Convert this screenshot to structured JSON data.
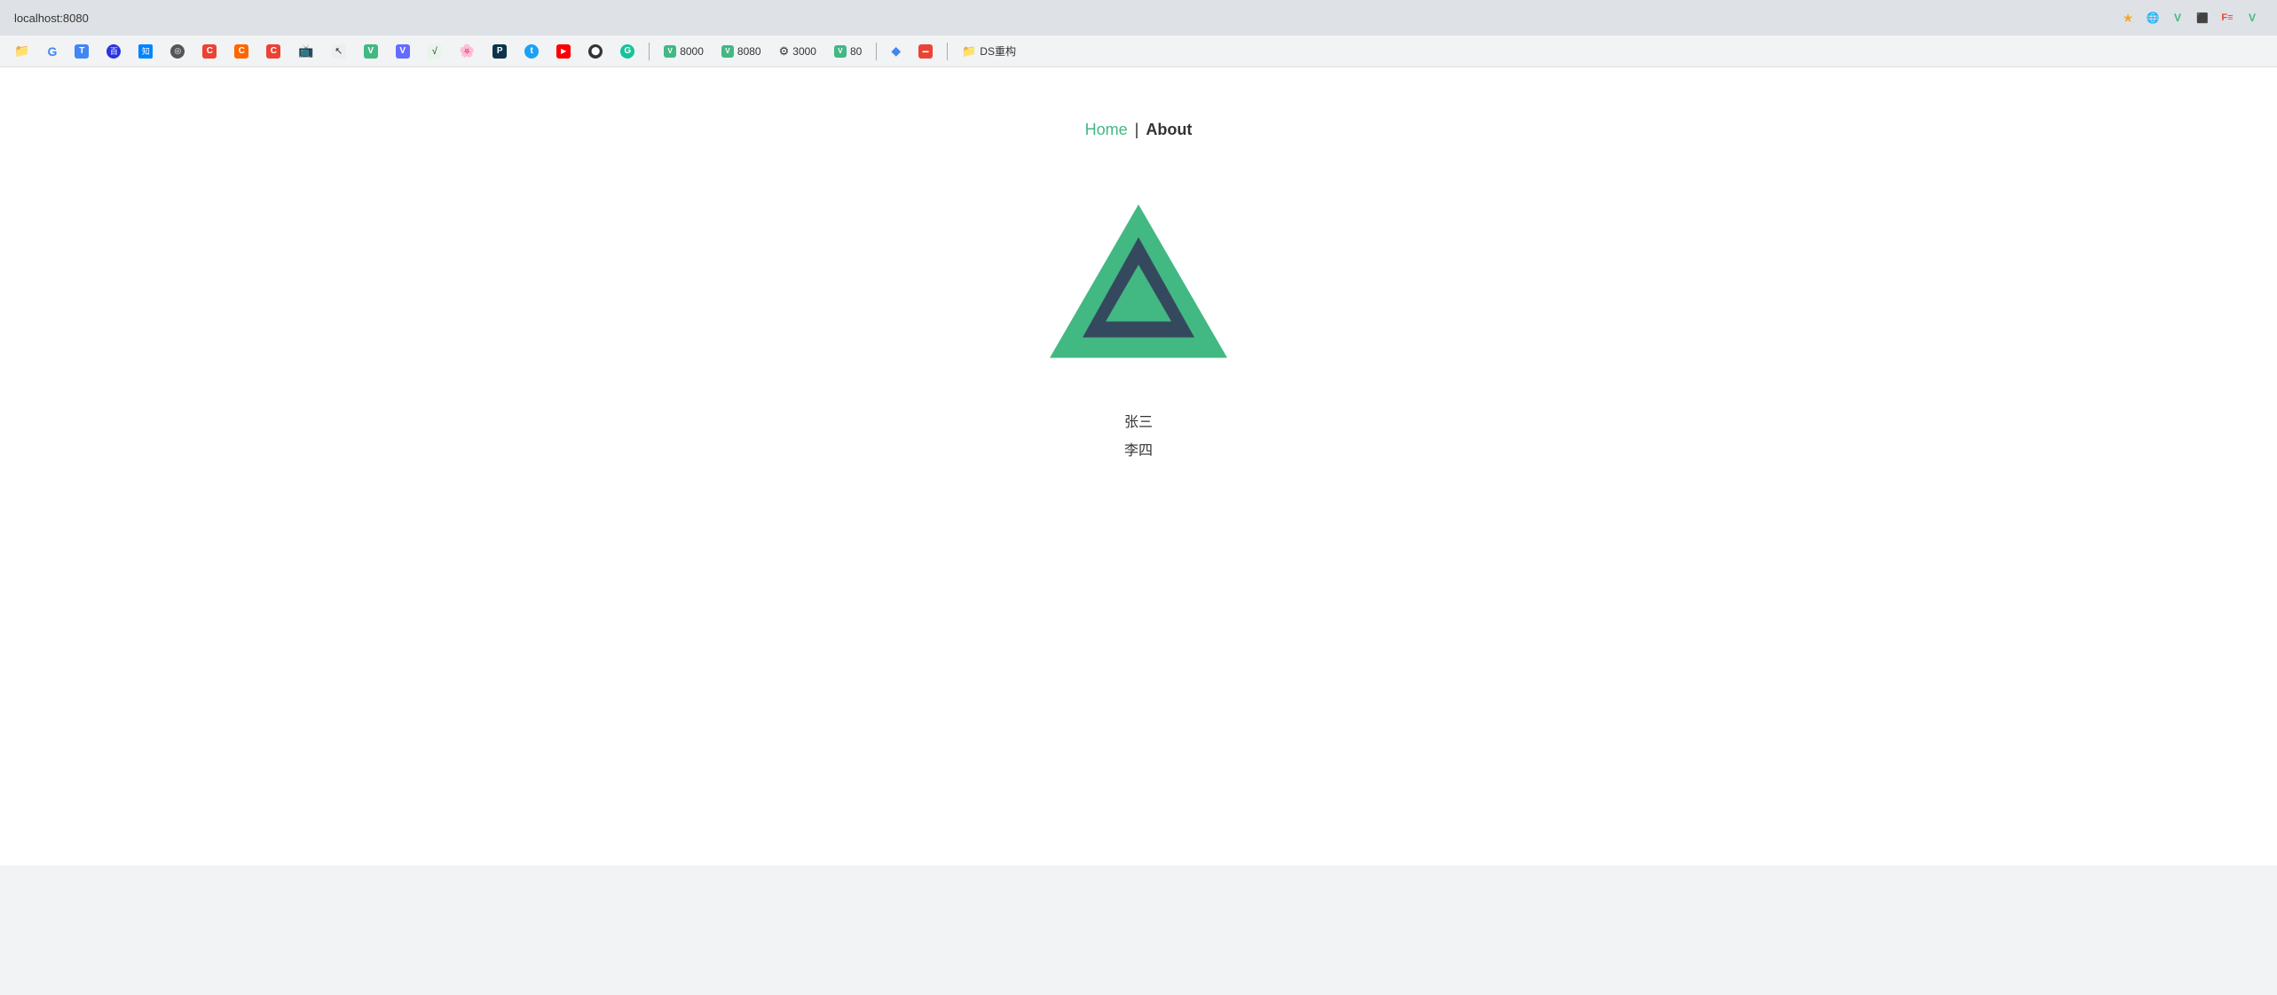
{
  "browser": {
    "url": "localhost:8080",
    "title": "localhost:8080"
  },
  "bookmarks": [
    {
      "id": "folder",
      "label": "",
      "icon": "folder",
      "type": "folder"
    },
    {
      "id": "google",
      "label": "",
      "icon": "G",
      "color": "google"
    },
    {
      "id": "translate",
      "label": "",
      "icon": "T",
      "color": "blue"
    },
    {
      "id": "baidu",
      "label": "",
      "icon": "百",
      "color": "blue"
    },
    {
      "id": "zhihu",
      "label": "",
      "icon": "知",
      "color": "blue"
    },
    {
      "id": "site1",
      "label": "",
      "icon": "◎",
      "color": "dark"
    },
    {
      "id": "c1",
      "label": "",
      "icon": "C",
      "color": "red"
    },
    {
      "id": "c2",
      "label": "",
      "icon": "C",
      "color": "orange"
    },
    {
      "id": "c3",
      "label": "",
      "icon": "C",
      "color": "red"
    },
    {
      "id": "tv",
      "label": "",
      "icon": "📺",
      "color": "blue"
    },
    {
      "id": "cursor",
      "label": "",
      "icon": "↖",
      "color": "dark"
    },
    {
      "id": "vue1",
      "label": "",
      "icon": "V",
      "color": "green"
    },
    {
      "id": "vite",
      "label": "",
      "icon": "V",
      "color": "dark"
    },
    {
      "id": "math",
      "label": "",
      "icon": "√",
      "color": "dark"
    },
    {
      "id": "flower",
      "label": "",
      "icon": "❀",
      "color": "dark"
    },
    {
      "id": "prisma",
      "label": "",
      "icon": "P",
      "color": "blue"
    },
    {
      "id": "twitter",
      "label": "",
      "icon": "t",
      "color": "blue"
    },
    {
      "id": "youtube",
      "label": "",
      "icon": "▶",
      "color": "red"
    },
    {
      "id": "github",
      "label": "",
      "icon": "⬤",
      "color": "dark"
    },
    {
      "id": "grammarly",
      "label": "",
      "icon": "G",
      "color": "green"
    },
    {
      "id": "bm-8000",
      "label": "8000",
      "icon": "V",
      "color": "green"
    },
    {
      "id": "bm-8080",
      "label": "8080",
      "icon": "V",
      "color": "green"
    },
    {
      "id": "bm-3000",
      "label": "3000",
      "icon": "⚙",
      "color": "dark"
    },
    {
      "id": "bm-80",
      "label": "80",
      "icon": "V",
      "color": "green"
    },
    {
      "id": "diamond",
      "label": "",
      "icon": "◆",
      "color": "blue"
    },
    {
      "id": "minus",
      "label": "",
      "icon": "−",
      "color": "red"
    },
    {
      "id": "ds",
      "label": "DS重构",
      "icon": "📁",
      "color": "folder"
    }
  ],
  "nav": {
    "home_label": "Home",
    "separator": "|",
    "about_label": "About",
    "home_href": "/",
    "about_href": "/about"
  },
  "content": {
    "name1": "张三",
    "name2": "李四"
  },
  "vue_logo": {
    "outer_color": "#42b883",
    "inner_color": "#35495e"
  }
}
